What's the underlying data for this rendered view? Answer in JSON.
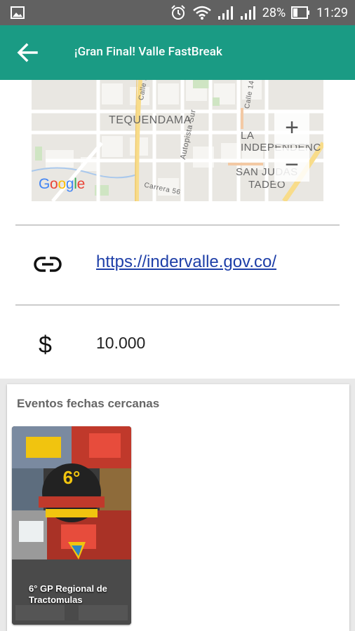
{
  "status_bar": {
    "battery": "28%",
    "time": "11:29",
    "icons": [
      "image-icon",
      "alarm-icon",
      "wifi-icon",
      "signal-icon",
      "signal-icon",
      "battery-icon"
    ]
  },
  "app_bar": {
    "title": "¡Gran Final! Valle FastBreak",
    "back_icon": "arrow-back-icon"
  },
  "map": {
    "labels": {
      "tequendama": "TEQUENDAMA",
      "independencia": "LA INDEPENDENC",
      "san_judas": "SAN JUDAS",
      "tadeo": "TADEO",
      "autopista": "Autopista Sur",
      "carrera": "Carrera 56",
      "calle": "Calle 14",
      "calle2": "Calle 5"
    },
    "zoom_in": "+",
    "zoom_out": "−",
    "attribution": "Google"
  },
  "details": {
    "link_icon": "link-icon",
    "link": "https://indervalle.gov.co/",
    "price_icon": "$",
    "price": "10.000"
  },
  "events": {
    "title": "Eventos fechas cercanas",
    "items": [
      {
        "caption": "6° GP Regional de Tractomulas"
      }
    ]
  },
  "colors": {
    "app_bar": "#1a9b84",
    "status_bar": "#616161",
    "link": "#1e3fa8"
  }
}
